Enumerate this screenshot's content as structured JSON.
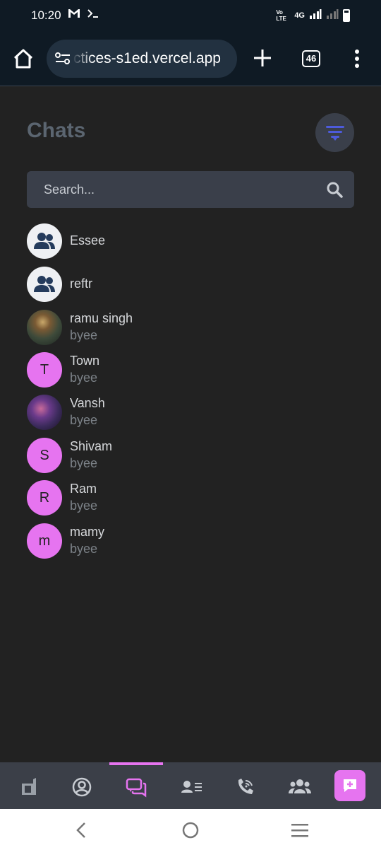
{
  "status_bar": {
    "time": "10:20",
    "left_icons": [
      "gmail-icon",
      "terminal-icon"
    ],
    "network_label": "Vo LTE",
    "signal_label": "4G"
  },
  "browser": {
    "url": "ctices-s1ed.vercel.app",
    "tab_count": "46"
  },
  "header": {
    "title": "Chats"
  },
  "search": {
    "placeholder": "Search..."
  },
  "chats": [
    {
      "name": "Essee",
      "subtitle": "",
      "avatar": "group"
    },
    {
      "name": "reftr",
      "subtitle": "",
      "avatar": "group"
    },
    {
      "name": "ramu singh",
      "subtitle": "byee",
      "avatar": "photo"
    },
    {
      "name": "Town",
      "subtitle": "byee",
      "avatar": "T"
    },
    {
      "name": "Vansh",
      "subtitle": "byee",
      "avatar": "photo"
    },
    {
      "name": "Shivam",
      "subtitle": "byee",
      "avatar": "S"
    },
    {
      "name": "Ram",
      "subtitle": "byee",
      "avatar": "R"
    },
    {
      "name": "mamy",
      "subtitle": "byee",
      "avatar": "m"
    }
  ],
  "bottom_nav": {
    "items": [
      "app-logo-icon",
      "profile-icon",
      "chats-icon",
      "contacts-icon",
      "calls-icon",
      "groups-icon"
    ],
    "active": "chats-icon"
  },
  "colors": {
    "accent": "#e674f0",
    "background": "#222222",
    "filter_icon": "#4d5bdc"
  }
}
